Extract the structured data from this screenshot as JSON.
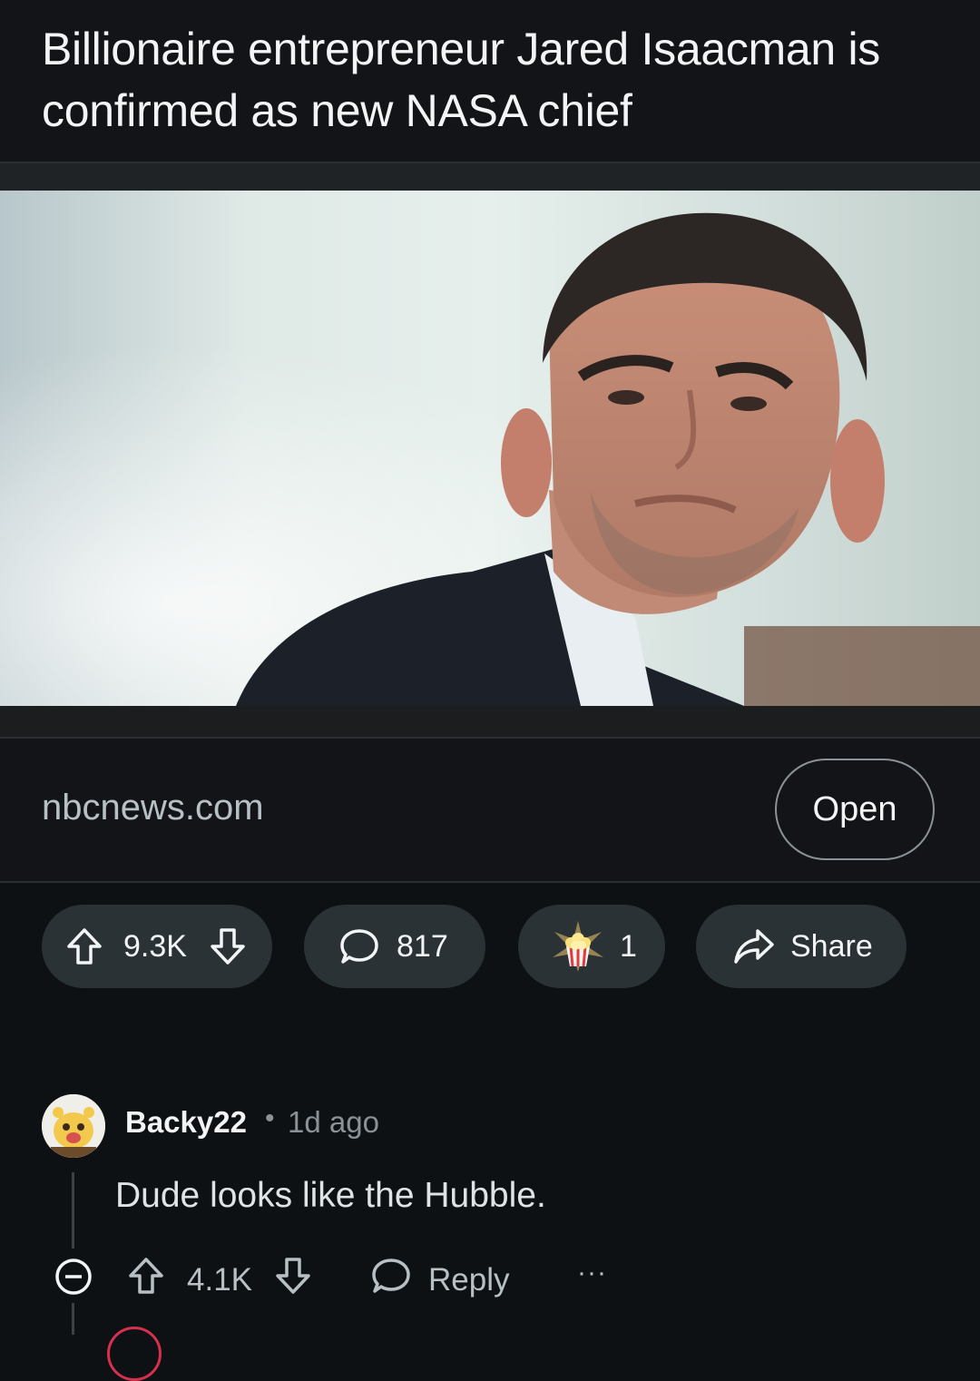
{
  "post": {
    "title": "Billionaire entrepreneur Jared Isaacman is confirmed as new NASA chief",
    "domain": "nbcnews.com",
    "open_label": "Open",
    "upvotes": "9.3K",
    "comments": "817",
    "awards": "1",
    "share_label": "Share"
  },
  "comment": {
    "author": "Backy22",
    "separator": "•",
    "time": "1d ago",
    "text": "Dude looks like the Hubble.",
    "votes": "4.1K",
    "reply_label": "Reply",
    "more_label": "···"
  },
  "colors": {
    "background": "#0e1113",
    "card": "#121417",
    "pill": "#2a3236",
    "muted_text": "#8a9297"
  },
  "icons": [
    "upvote-icon",
    "downvote-icon",
    "comment-icon",
    "popcorn-award-icon",
    "share-icon",
    "collapse-icon",
    "reply-icon",
    "more-icon"
  ]
}
